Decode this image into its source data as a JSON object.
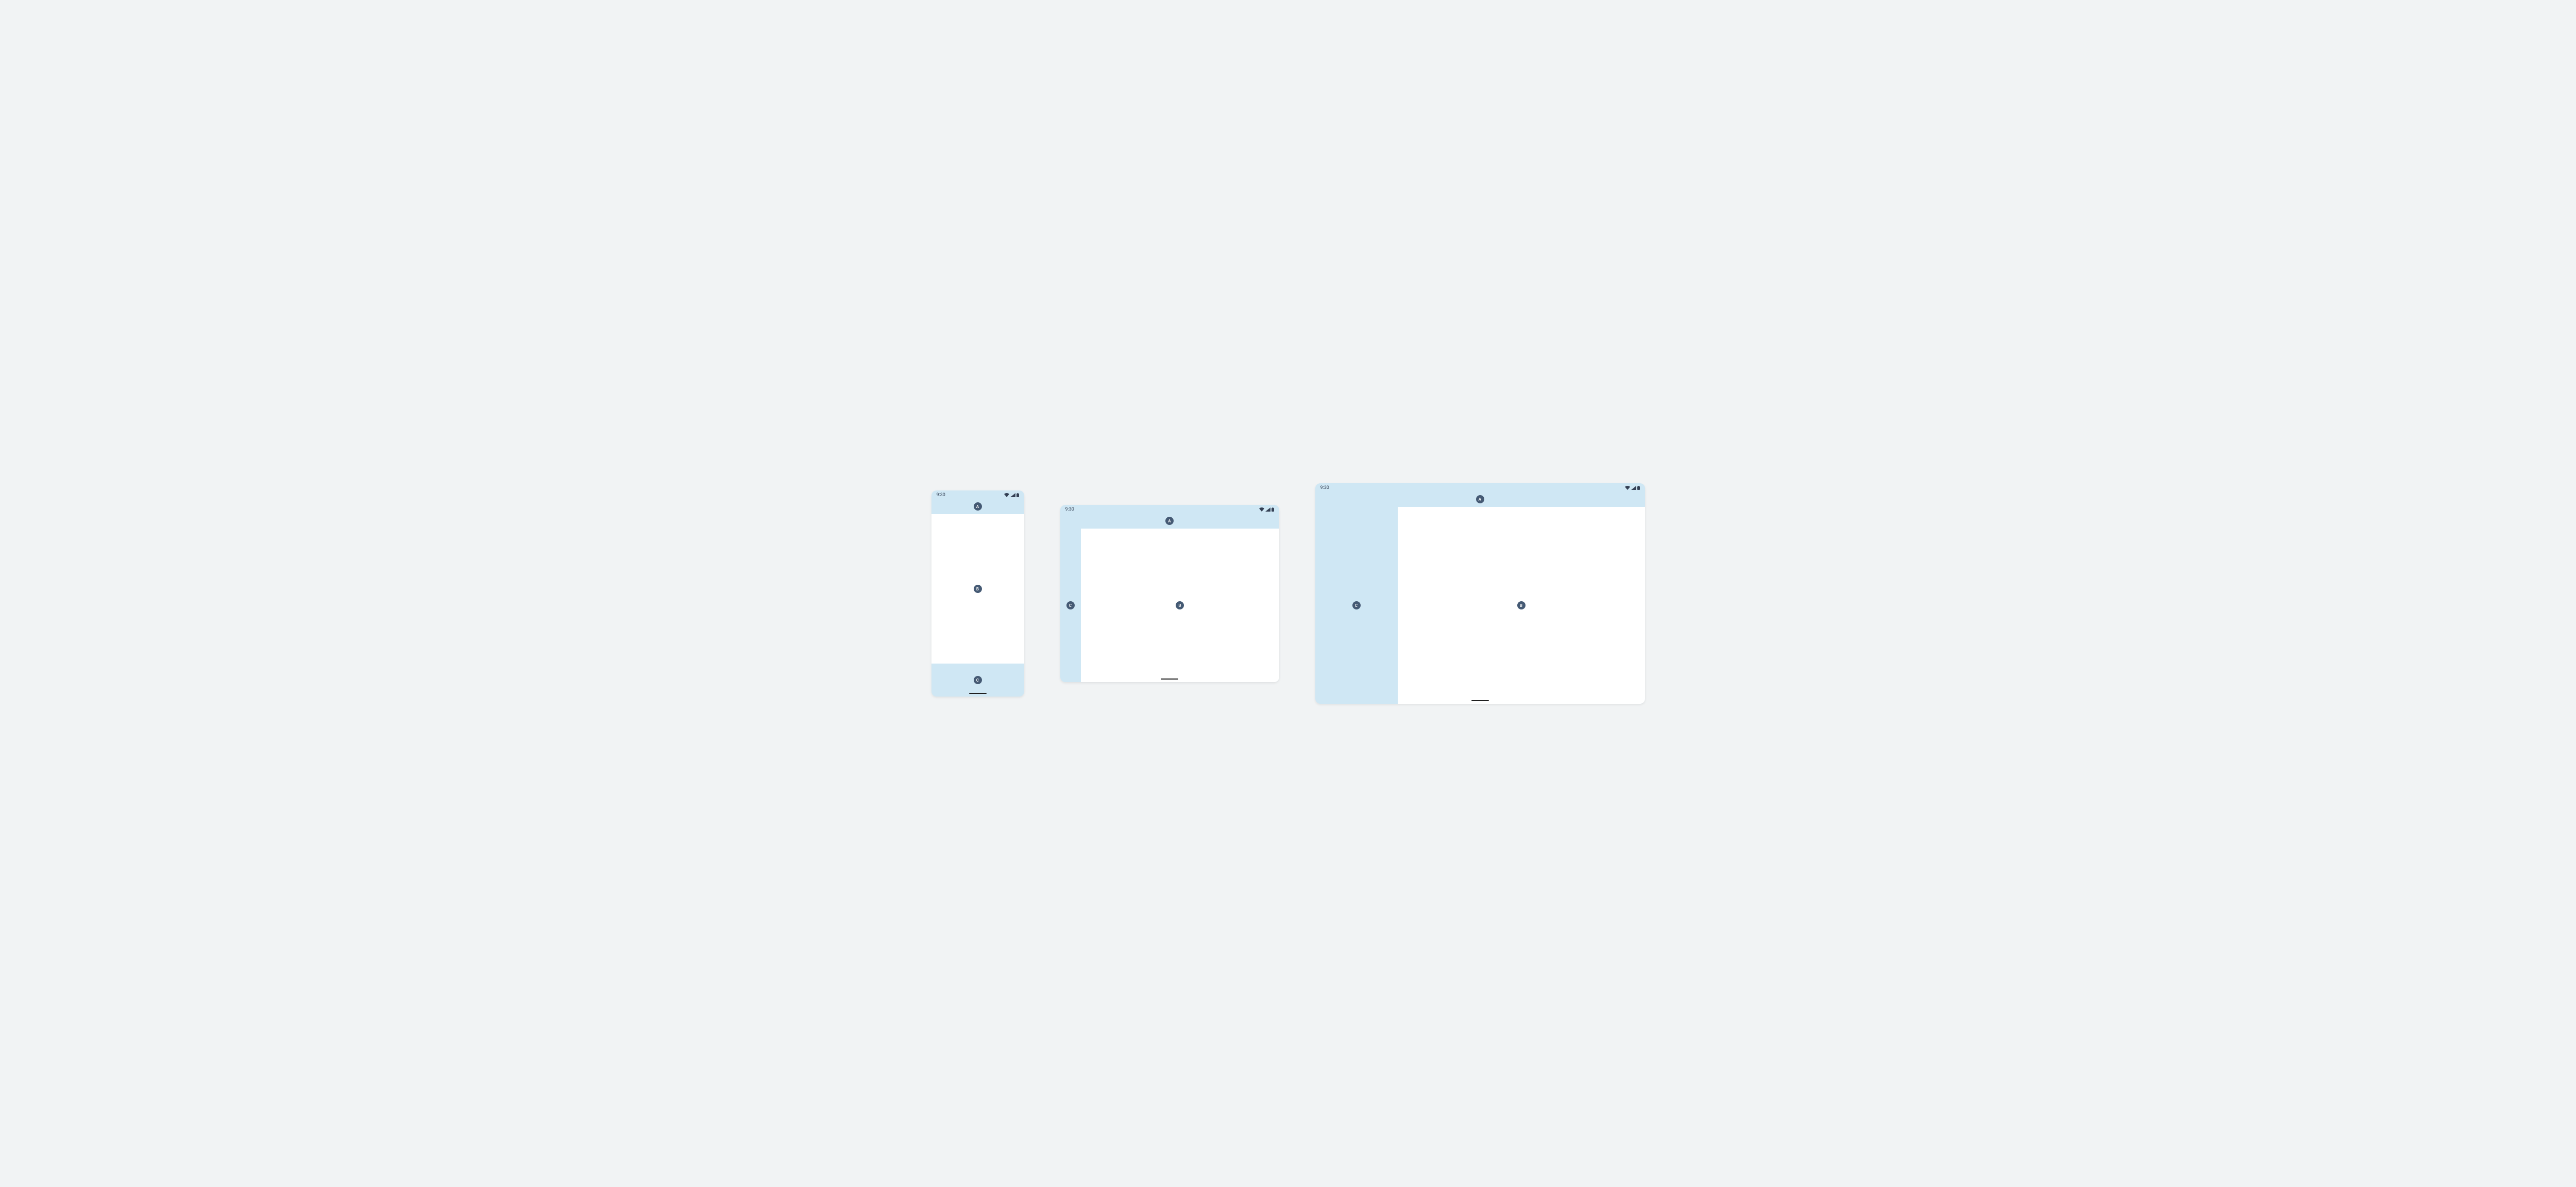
{
  "status": {
    "time": "9:30"
  },
  "badge": {
    "a": "A",
    "b": "B",
    "c": "C"
  },
  "devices": [
    "phone",
    "tablet",
    "desktop"
  ]
}
